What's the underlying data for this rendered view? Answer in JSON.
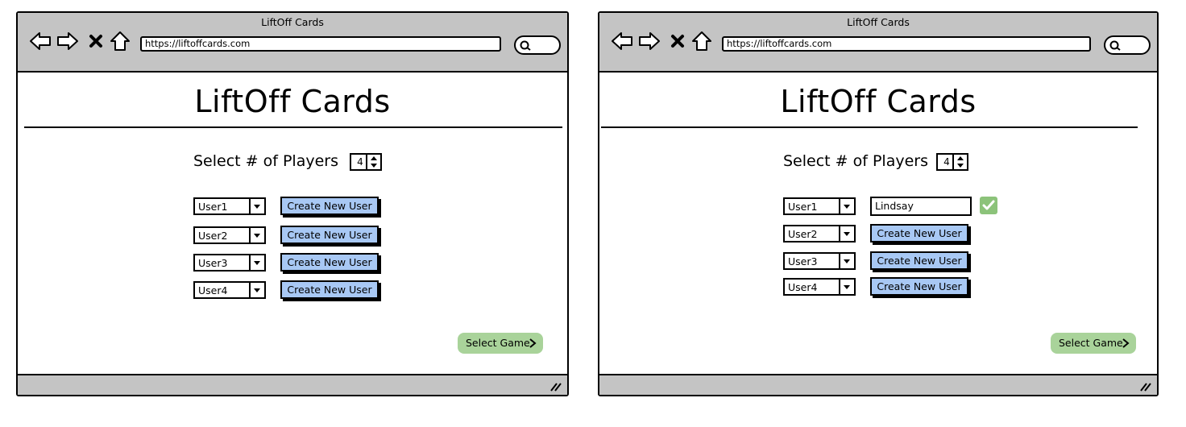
{
  "windows": [
    {
      "title": "LiftOff Cards",
      "url": "https://liftoffcards.com",
      "heading": "LiftOff Cards",
      "players_label": "Select # of Players",
      "players_count": "4",
      "rows": [
        {
          "user": "User1",
          "action_label": "Create New User"
        },
        {
          "user": "User2",
          "action_label": "Create New User"
        },
        {
          "user": "User3",
          "action_label": "Create New User"
        },
        {
          "user": "User4",
          "action_label": "Create New User"
        }
      ],
      "select_game_label": "Select Game"
    },
    {
      "title": "LiftOff Cards",
      "url": "https://liftoffcards.com",
      "heading": "LiftOff Cards",
      "players_label": "Select # of Players",
      "players_count": "4",
      "rows": [
        {
          "user": "User1",
          "name_value": "Lindsay",
          "confirmed": true
        },
        {
          "user": "User2",
          "action_label": "Create New User"
        },
        {
          "user": "User3",
          "action_label": "Create New User"
        },
        {
          "user": "User4",
          "action_label": "Create New User"
        }
      ],
      "select_game_label": "Select Game"
    }
  ],
  "icons": {
    "nav": [
      "back-arrow-icon",
      "forward-arrow-icon",
      "stop-icon",
      "home-icon"
    ],
    "search": "search-icon",
    "confirm": "checkmark-icon",
    "chevron": "chevron-right-icon",
    "resize": "resize-grip-icon"
  },
  "colors": {
    "chrome": "#c4c4c4",
    "button_blue": "#a8c8f4",
    "confirm_green": "#8cc37a",
    "select_game_green": "#a9d39a"
  }
}
